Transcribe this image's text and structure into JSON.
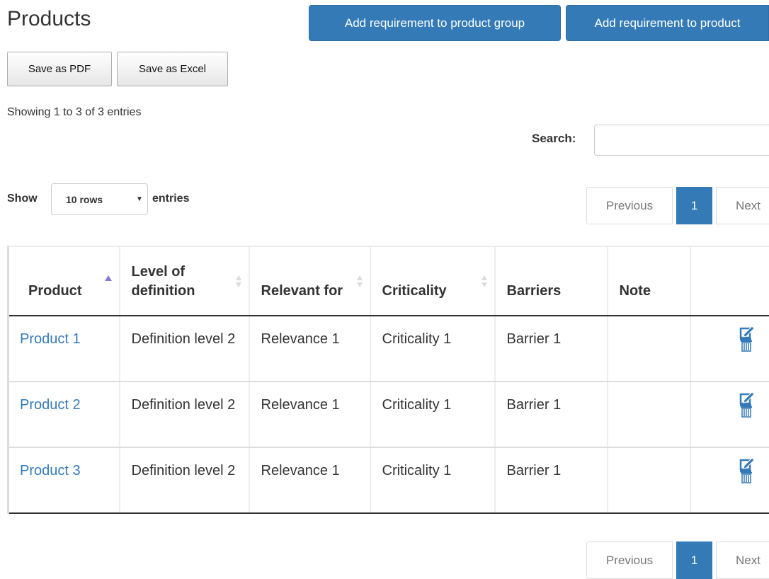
{
  "page": {
    "title": "Products"
  },
  "header": {
    "add_group_label": "Add requirement to product group",
    "add_product_label": "Add requirement to product"
  },
  "export": {
    "pdf_label": "Save as PDF",
    "excel_label": "Save as Excel"
  },
  "info": {
    "text": "Showing 1 to 3 of 3 entries"
  },
  "search": {
    "label": "Search:",
    "value": "",
    "placeholder": ""
  },
  "length": {
    "show_label": "Show",
    "selected": "10 rows",
    "entries_label": "entries"
  },
  "pagination": {
    "previous": "Previous",
    "current": "1",
    "next": "Next"
  },
  "table": {
    "columns": [
      "Product",
      "Level of definition",
      "Relevant for",
      "Criticality",
      "Barriers",
      "Note",
      ""
    ],
    "sorted_column": "Product",
    "rows": [
      {
        "product": "Product 1",
        "level": "Definition level 2",
        "relevant": "Relevance 1",
        "criticality": "Criticality 1",
        "barriers": "Barrier 1",
        "note": ""
      },
      {
        "product": "Product 2",
        "level": "Definition level 2",
        "relevant": "Relevance 1",
        "criticality": "Criticality 1",
        "barriers": "Barrier 1",
        "note": ""
      },
      {
        "product": "Product 3",
        "level": "Definition level 2",
        "relevant": "Relevance 1",
        "criticality": "Criticality 1",
        "barriers": "Barrier 1",
        "note": ""
      }
    ]
  },
  "icons": {
    "edit": "edit-icon",
    "delete": "delete-icon",
    "sort": "sort-icon",
    "caret": "chevron-down-icon"
  },
  "colors": {
    "primary": "#337ab7",
    "link": "#337ab7",
    "sort_active": "#8476d7"
  }
}
